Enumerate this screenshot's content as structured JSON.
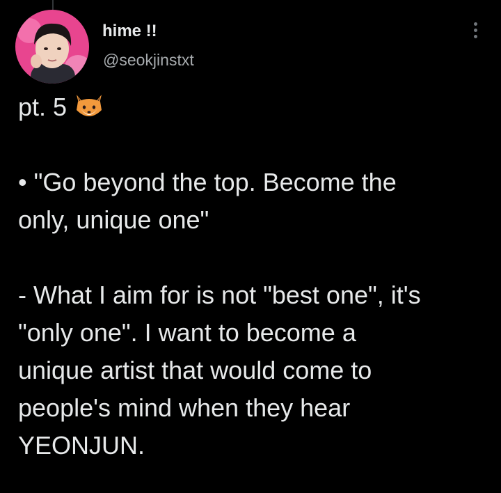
{
  "author": {
    "display_name": "hime !!",
    "handle": "@seokjinstxt",
    "avatar_icon": "avatar-photo"
  },
  "menu": {
    "icon": "more-dots-icon"
  },
  "tweet": {
    "line1_text": "pt. 5",
    "line1_emoji": "fox-face-icon",
    "quote_line1": "• \"Go beyond the top. Become the",
    "quote_line2": "only, unique one\"",
    "para_line1": "- What I aim for is not \"best one\", it's",
    "para_line2": "\"only one\". I want to become a",
    "para_line3": "unique artist that would come to",
    "para_line4": "people's mind when they hear",
    "para_line5": "YEONJUN."
  },
  "colors": {
    "background": "#000000",
    "text": "#e7e9ea",
    "secondary_text": "#a7abae",
    "avatar_bg": "#e8458f"
  }
}
